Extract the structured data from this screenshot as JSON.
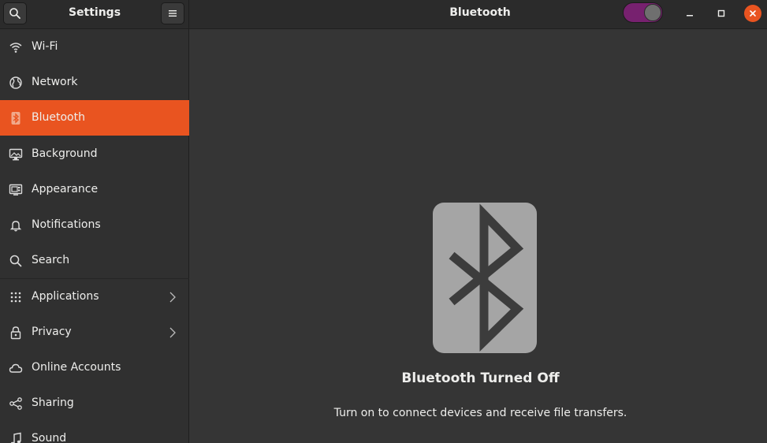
{
  "header": {
    "sidebar_title": "Settings",
    "page_title": "Bluetooth",
    "bluetooth_switch_on": false
  },
  "sidebar": {
    "items": [
      {
        "label": "Wi-Fi",
        "icon": "wifi-icon"
      },
      {
        "label": "Network",
        "icon": "globe-icon"
      },
      {
        "label": "Bluetooth",
        "icon": "bluetooth-icon",
        "active": true
      },
      {
        "label": "Background",
        "icon": "monitor-icon"
      },
      {
        "label": "Appearance",
        "icon": "appearance-icon"
      },
      {
        "label": "Notifications",
        "icon": "bell-icon"
      },
      {
        "label": "Search",
        "icon": "search-icon"
      },
      {
        "label": "Applications",
        "icon": "grid-icon",
        "submenu": true
      },
      {
        "label": "Privacy",
        "icon": "lock-icon",
        "submenu": true
      },
      {
        "label": "Online Accounts",
        "icon": "cloud-icon"
      },
      {
        "label": "Sharing",
        "icon": "share-icon"
      },
      {
        "label": "Sound",
        "icon": "music-note-icon"
      }
    ]
  },
  "main": {
    "status_title": "Bluetooth Turned Off",
    "status_description": "Turn on to connect devices and receive file transfers."
  },
  "colors": {
    "accent": "#e95420",
    "switch_track": "#77216f",
    "background": "#353535",
    "sidebar": "#303030"
  }
}
